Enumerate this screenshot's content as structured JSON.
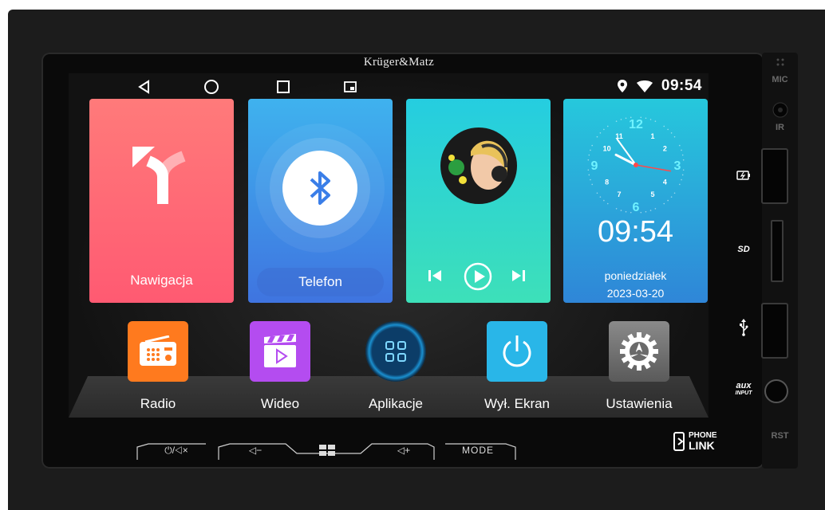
{
  "brand": "Krüger&Matz",
  "status": {
    "time": "09:54"
  },
  "nav_buttons": [
    "back",
    "home",
    "recents",
    "split-screen"
  ],
  "tiles": {
    "navigation": {
      "label": "Nawigacja"
    },
    "phone": {
      "label": "Telefon"
    },
    "music": {
      "controls": [
        "previous",
        "play",
        "next"
      ]
    },
    "clock": {
      "time": "09:54",
      "day": "poniedziałek",
      "date": "2023-03-20",
      "numerals": [
        "12",
        "1",
        "2",
        "3",
        "4",
        "5",
        "6",
        "7",
        "8",
        "9",
        "10",
        "11"
      ]
    }
  },
  "apps": [
    {
      "label": "Radio",
      "color": "#ff7a1e"
    },
    {
      "label": "Wideo",
      "color": "#b44cf0"
    },
    {
      "label": "Aplikacje",
      "color": "#0c3d68"
    },
    {
      "label": "Wył. Ekran",
      "color": "#29b6e8"
    },
    {
      "label": "Ustawienia",
      "color": "#6e6e6e"
    }
  ],
  "hardware": {
    "power_mute": "⏻/◁×",
    "vol_down": "◁−",
    "vol_up": "◁+",
    "mode": "MODE",
    "phonelink_top": "PHONE",
    "phonelink_bottom": "LINK"
  },
  "side_panel": {
    "mic": "MIC",
    "ir": "IR",
    "sd": "SD",
    "aux_top": "aux",
    "aux_bottom": "INPUT",
    "rst": "RST"
  },
  "colors": {
    "accent_teal": "#26c8dc",
    "nav_red": "#ff5a72",
    "bt_blue": "#3f74e0"
  }
}
